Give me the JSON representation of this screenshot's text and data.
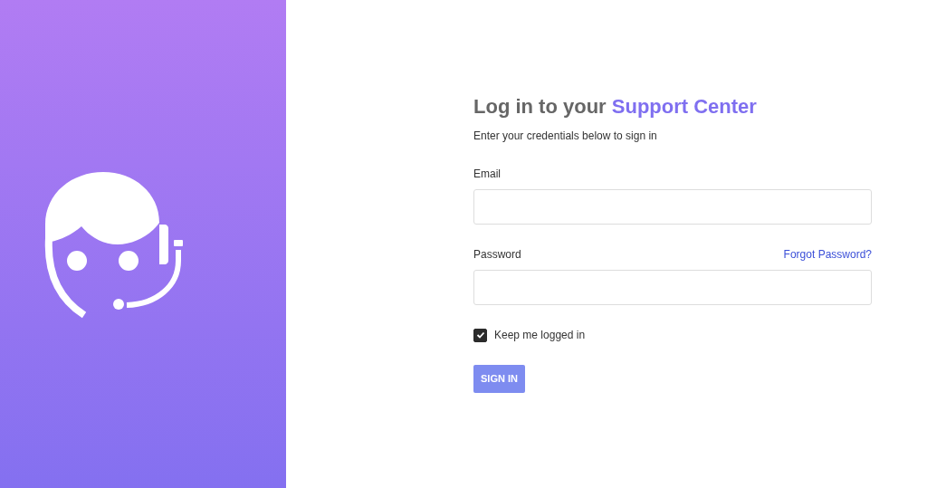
{
  "title": {
    "text": "Log in to your",
    "highlight": "Support Center"
  },
  "subtitle": "Enter your credentials below to sign in",
  "fields": [
    {
      "label": "Email"
    },
    {
      "label": "Password",
      "link": "Forgot Password?"
    }
  ],
  "remember": {
    "label": "Keep me logged in",
    "checked": true
  },
  "button": "SIGN IN"
}
